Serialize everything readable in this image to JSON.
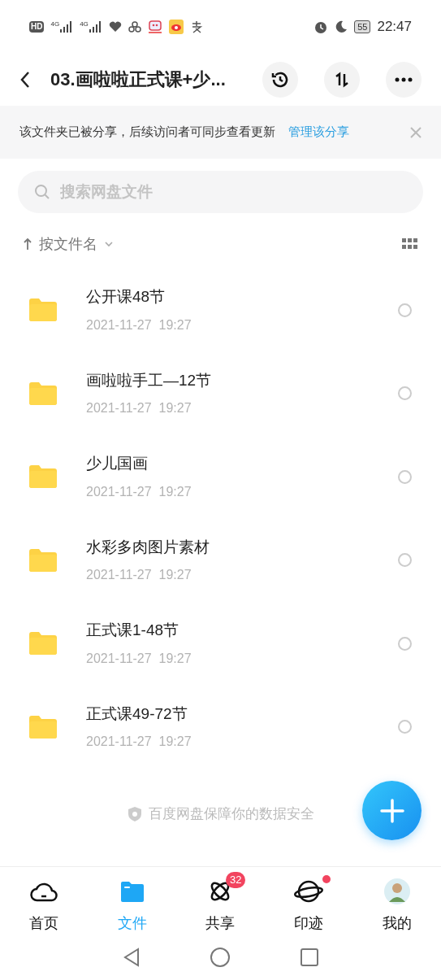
{
  "status_bar": {
    "hd_label": "HD",
    "network_labels": [
      "4G",
      "4G"
    ],
    "battery": "55",
    "time": "22:47"
  },
  "header": {
    "title": "03.画啦啦正式课+少..."
  },
  "share_banner": {
    "text": "该文件夹已被分享，后续访问者可同步查看更新",
    "link": "管理该分享"
  },
  "search": {
    "placeholder": "搜索网盘文件"
  },
  "sort": {
    "label": "按文件名"
  },
  "files": [
    {
      "name": "公开课48节",
      "date": "2021-11-27  19:27",
      "selected": false
    },
    {
      "name": "画啦啦手工—12节",
      "date": "2021-11-27  19:27",
      "selected": false
    },
    {
      "name": "少儿国画",
      "date": "2021-11-27  19:27",
      "selected": false
    },
    {
      "name": "水彩多肉图片素材",
      "date": "2021-11-27  19:27",
      "selected": false
    },
    {
      "name": "正式课1-48节",
      "date": "2021-11-27  19:27",
      "selected": false
    },
    {
      "name": "正式课49-72节",
      "date": "2021-11-27  19:27",
      "selected": false
    }
  ],
  "footer_note": "百度网盘保障你的数据安全",
  "bottom_nav": [
    {
      "label": "首页",
      "kind": "cloud",
      "selected": false
    },
    {
      "label": "文件",
      "kind": "folder",
      "selected": true
    },
    {
      "label": "共享",
      "kind": "atom",
      "selected": false,
      "badge": "32"
    },
    {
      "label": "印迹",
      "kind": "planet",
      "selected": false,
      "dot": true
    },
    {
      "label": "我的",
      "kind": "avatar",
      "selected": false
    }
  ]
}
